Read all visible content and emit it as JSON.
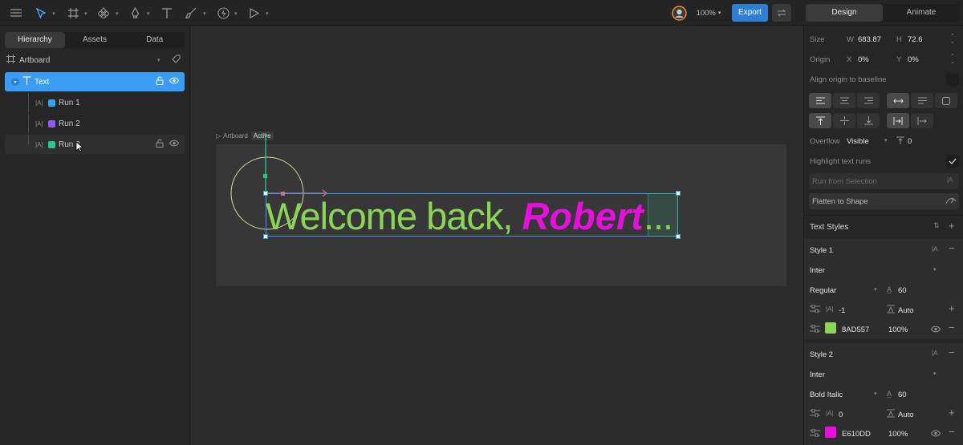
{
  "toolbar": {
    "zoom": "100%",
    "export_label": "Export",
    "mode_tabs": [
      {
        "label": "Design"
      },
      {
        "label": "Animate"
      }
    ]
  },
  "left_panel": {
    "tabs": [
      {
        "label": "Hierarchy"
      },
      {
        "label": "Assets"
      },
      {
        "label": "Data"
      }
    ],
    "artboard_label": "Artboard",
    "items": [
      {
        "label": "Text",
        "selected": true
      },
      {
        "label": "Run 1",
        "color": "#33A3F4"
      },
      {
        "label": "Run 2",
        "color": "#8B5CF6"
      },
      {
        "label": "Run 3",
        "color": "#2DC48D"
      }
    ]
  },
  "canvas": {
    "artboard_label": "Artboard",
    "active_badge": "Active",
    "text_run_1": "Welcome back, ",
    "text_run_2": "Robert",
    "ellipsis": "...",
    "run_1_color": "#8AD557",
    "run_2_color": "#E610DD"
  },
  "right_panel": {
    "size_label": "Size",
    "w_label": "W",
    "w_value": "683.87",
    "h_label": "H",
    "h_value": "72.6",
    "origin_label": "Origin",
    "x_label": "X",
    "x_value": "0%",
    "y_label": "Y",
    "y_value": "0%",
    "align_origin_label": "Align origin to baseline",
    "overflow_label": "Overflow",
    "overflow_value": "Visible",
    "paragraph_spacing": "0",
    "highlight_runs_label": "Highlight text runs",
    "run_from_selection_label": "Run from Selection",
    "flatten_label": "Flatten to Shape",
    "text_styles_label": "Text Styles",
    "styles": [
      {
        "name": "Style 1",
        "font": "Inter",
        "weight": "Regular",
        "size": "60",
        "letter_spacing": "-1",
        "line_height": "Auto",
        "color_hex": "8AD557",
        "opacity": "100%",
        "color": "#8AD557"
      },
      {
        "name": "Style 2",
        "font": "Inter",
        "weight": "Bold Italic",
        "size": "60",
        "letter_spacing": "0",
        "line_height": "Auto",
        "color_hex": "E610DD",
        "opacity": "100%",
        "color": "#E610DD"
      }
    ]
  }
}
